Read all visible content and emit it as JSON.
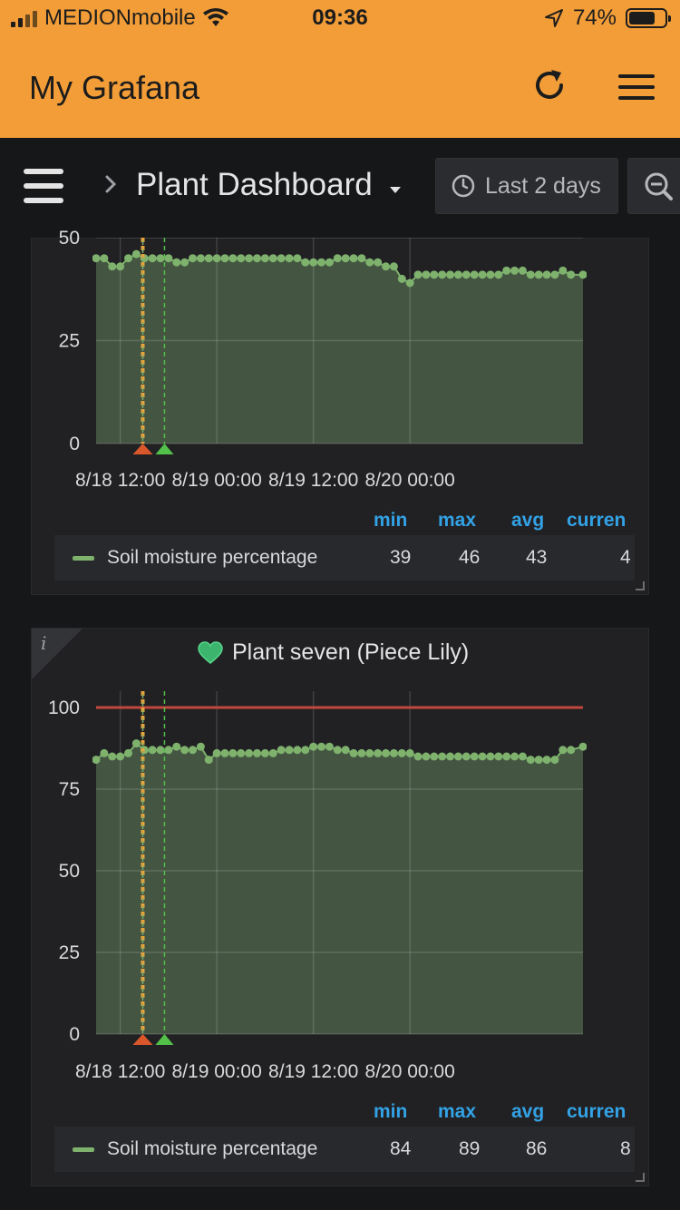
{
  "status_bar": {
    "carrier": "MEDIONmobile",
    "time": "09:36",
    "battery": "74%",
    "battery_level": 0.74
  },
  "app_bar": {
    "title": "My Grafana"
  },
  "nav": {
    "dashboard_title": "Plant Dashboard",
    "time_range": "Last 2 days"
  },
  "colors": {
    "accent_orange": "#f29d38",
    "series_green": "#7eb26d",
    "threshold_red": "#c4473c",
    "legend_header_blue": "#33a2e5"
  },
  "panels": [
    {
      "title": "",
      "legend": {
        "headers": [
          "min",
          "max",
          "avg",
          "curren"
        ],
        "series_name": "Soil moisture percentage",
        "min": "39",
        "max": "46",
        "avg": "43",
        "current": "4"
      }
    },
    {
      "title": "Plant seven (Piece Lily)",
      "icon": "heart-icon",
      "legend": {
        "headers": [
          "min",
          "max",
          "avg",
          "curren"
        ],
        "series_name": "Soil moisture percentage",
        "min": "84",
        "max": "89",
        "avg": "86",
        "current": "8"
      }
    }
  ],
  "chart_data": [
    {
      "type": "area",
      "title": "",
      "xlabel": "",
      "ylabel": "",
      "x_ticks": [
        "8/18 12:00",
        "8/19 00:00",
        "8/19 12:00",
        "8/20 00:00"
      ],
      "y_ticks": [
        "0",
        "25",
        "50"
      ],
      "ylim": [
        0,
        50
      ],
      "xlim_hours": [
        -3,
        57.5
      ],
      "x_tick_hours": [
        0,
        12,
        24,
        36
      ],
      "series": [
        {
          "name": "Soil moisture percentage",
          "x_hours": [
            -3,
            -2,
            -1,
            0,
            1,
            2,
            3,
            4,
            5,
            6,
            7,
            8,
            9,
            10,
            11,
            12,
            13,
            14,
            15,
            16,
            17,
            18,
            19,
            20,
            21,
            22,
            23,
            24,
            25,
            26,
            27,
            28,
            29,
            30,
            31,
            32,
            33,
            34,
            35,
            36,
            37,
            38,
            39,
            40,
            41,
            42,
            43,
            44,
            45,
            46,
            47,
            48,
            49,
            50,
            51,
            52,
            53,
            54,
            55,
            56,
            57.5
          ],
          "values": [
            45,
            45,
            43,
            43,
            45,
            46,
            45,
            45,
            45,
            45,
            44,
            44,
            45,
            45,
            45,
            45,
            45,
            45,
            45,
            45,
            45,
            45,
            45,
            45,
            45,
            45,
            44,
            44,
            44,
            44,
            45,
            45,
            45,
            45,
            44,
            44,
            43,
            43,
            40,
            39,
            41,
            41,
            41,
            41,
            41,
            41,
            41,
            41,
            41,
            41,
            41,
            42,
            42,
            42,
            41,
            41,
            41,
            41,
            42,
            41,
            41
          ]
        }
      ],
      "annotations": [
        {
          "x_hours": 2.8,
          "color": "orange"
        },
        {
          "x_hours": 5.5,
          "color": "green"
        }
      ],
      "grid": true,
      "legend": "bottom"
    },
    {
      "type": "area",
      "title": "Plant seven (Piece Lily)",
      "xlabel": "",
      "ylabel": "",
      "x_ticks": [
        "8/18 12:00",
        "8/19 00:00",
        "8/19 12:00",
        "8/20 00:00"
      ],
      "y_ticks": [
        "0",
        "25",
        "50",
        "75",
        "100"
      ],
      "ylim": [
        0,
        100
      ],
      "xlim_hours": [
        -3,
        57.5
      ],
      "x_tick_hours": [
        0,
        12,
        24,
        36
      ],
      "threshold": 100,
      "series": [
        {
          "name": "Soil moisture percentage",
          "x_hours": [
            -3,
            -2,
            -1,
            0,
            1,
            2,
            3,
            4,
            5,
            6,
            7,
            8,
            9,
            10,
            11,
            12,
            13,
            14,
            15,
            16,
            17,
            18,
            19,
            20,
            21,
            22,
            23,
            24,
            25,
            26,
            27,
            28,
            29,
            30,
            31,
            32,
            33,
            34,
            35,
            36,
            37,
            38,
            39,
            40,
            41,
            42,
            43,
            44,
            45,
            46,
            47,
            48,
            49,
            50,
            51,
            52,
            53,
            54,
            55,
            56,
            57.5
          ],
          "values": [
            84,
            86,
            85,
            85,
            86,
            89,
            87,
            87,
            87,
            87,
            88,
            87,
            87,
            88,
            84,
            86,
            86,
            86,
            86,
            86,
            86,
            86,
            86,
            87,
            87,
            87,
            87,
            88,
            88,
            88,
            87,
            87,
            86,
            86,
            86,
            86,
            86,
            86,
            86,
            86,
            85,
            85,
            85,
            85,
            85,
            85,
            85,
            85,
            85,
            85,
            85,
            85,
            85,
            85,
            84,
            84,
            84,
            84,
            87,
            87,
            88
          ]
        }
      ],
      "annotations": [
        {
          "x_hours": 2.8,
          "color": "orange"
        },
        {
          "x_hours": 5.5,
          "color": "green"
        }
      ],
      "grid": true,
      "legend": "bottom"
    }
  ]
}
